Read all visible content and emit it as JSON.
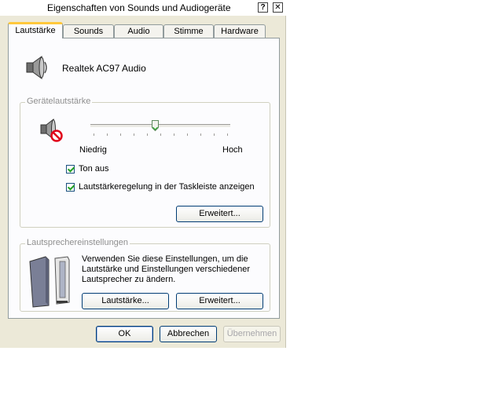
{
  "window": {
    "title": "Eigenschaften von Sounds und Audiogeräte",
    "help_glyph": "?",
    "close_glyph": "✕"
  },
  "tabs": [
    {
      "label": "Lautstärke",
      "active": true
    },
    {
      "label": "Sounds",
      "active": false
    },
    {
      "label": "Audio",
      "active": false
    },
    {
      "label": "Stimme",
      "active": false
    },
    {
      "label": "Hardware",
      "active": false
    }
  ],
  "device": {
    "name": "Realtek AC97 Audio",
    "icon": "speaker-icon"
  },
  "volume_group": {
    "label": "Gerätelautstärke",
    "icon": "speaker-muted-icon",
    "slider": {
      "value": 0.46,
      "min_label": "Niedrig",
      "max_label": "Hoch",
      "ticks": 11
    },
    "mute": {
      "label": "Ton aus",
      "checked": true
    },
    "taskbar": {
      "label": "Lautstärkeregelung in der Taskleiste anzeigen",
      "checked": true
    },
    "advanced_label": "Erweitert..."
  },
  "speaker_group": {
    "label": "Lautsprechereinstellungen",
    "icon": "speakers-icon",
    "description_lines": [
      "Verwenden Sie diese Einstellungen, um die",
      "Lautstärke und Einstellungen verschiedener",
      "Lautsprecher zu ändern."
    ],
    "volume_button": "Lautstärke...",
    "advanced_button": "Erweitert..."
  },
  "footer": {
    "ok": "OK",
    "cancel": "Abbrechen",
    "apply": "Übernehmen"
  },
  "colors": {
    "tab_highlight": "#ffc83c",
    "check_mark": "#21a121",
    "mute_red": "#e0001a",
    "dialog_bg": "#ece9d8",
    "panel_bg": "#fcfcfe"
  }
}
